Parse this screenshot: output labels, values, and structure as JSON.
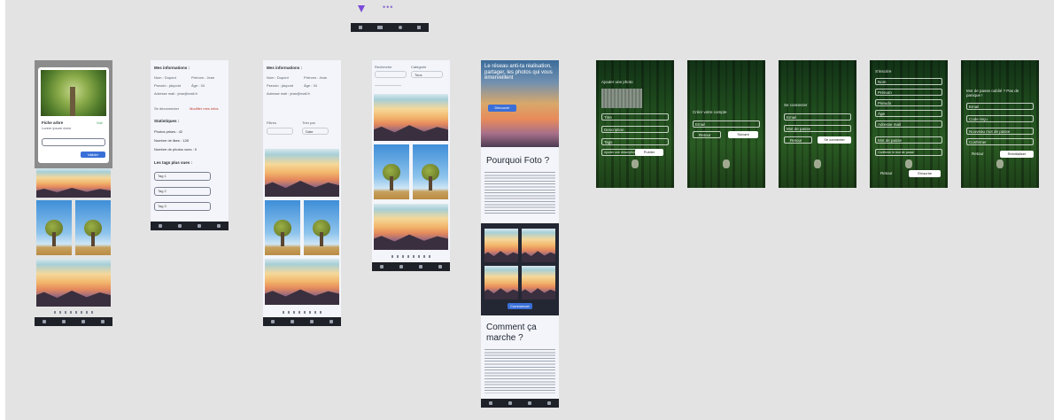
{
  "colors": {
    "canvas_bg": "#e3e3e3",
    "frame_bg": "#f3f5fa",
    "navbar_bg": "#1e2128",
    "accent_blue": "#3a6fd8",
    "link_red": "#c0392b",
    "selection_border": "#8c8c8c",
    "plugin_purple": "#7b4bd8"
  },
  "icons": [
    "component-icon",
    "home-icon",
    "search-icon",
    "back-icon",
    "menu-icon"
  ],
  "toolbar_top": {
    "badge": "•••"
  },
  "frame1": {
    "card_title": "Fiche arbre",
    "card_link": "Voir",
    "card_sub": "Lorem ipsum dolor",
    "card_btn": "Valider"
  },
  "frame2": {
    "title": "Mes informations :",
    "info_rows": [
      {
        "label": "Nom :",
        "value": "Dupont",
        "label2": "Prénom :",
        "value2": "Jean"
      },
      {
        "label": "Pseudo :",
        "value": "jdupont",
        "label2": "Âge :",
        "value2": "34"
      },
      {
        "label": "Adresse mail :",
        "value": "jean@mail.fr",
        "label2": "",
        "value2": ""
      }
    ],
    "logout": "Se déconnecter",
    "edit_link": "Modifier mes infos",
    "stats_title": "Statistiques :",
    "stats": [
      "Photos prises : 42",
      "Nombre de likes : 128",
      "Nombre de photos vues : 9"
    ],
    "tags_title": "Les tags plus vues :",
    "tags": [
      "Tag 1",
      "Tag 2",
      "Tag 3"
    ]
  },
  "frame3": {
    "title": "Mes informations :",
    "info_rows": [
      {
        "label": "Nom :",
        "value": "Dupont",
        "label2": "Prénom :",
        "value2": "Jean"
      },
      {
        "label": "Pseudo :",
        "value": "jdupont",
        "label2": "Âge :",
        "value2": "34"
      },
      {
        "label": "Adresse mail :",
        "value": "jean@mail.fr",
        "label2": "",
        "value2": ""
      }
    ],
    "field_a": "Filtres",
    "field_b": "Trier par",
    "field_value": "Date"
  },
  "frame4": {
    "field_a": "Recherche",
    "field_b": "Catégorie",
    "field_c": "Tous"
  },
  "landing": {
    "hero_text": "Le réseau anti-ta réalisation, partager, les photos qui vous émerveillent",
    "hero_btn": "Découvrir",
    "why_title": "Pourquoi Foto ?",
    "gallery_btn": "Commencer",
    "how_title": "Comment ça marche ?"
  },
  "forest_screens": [
    {
      "heading": "Ajouter une photo",
      "fields": [
        "Titre",
        "Description",
        "Tags",
        "Ajouter une description"
      ],
      "primary": "Publier"
    },
    {
      "heading": "Créer votre compte",
      "fields": [
        "Email"
      ],
      "secondary": "Retour",
      "primary": "Suivant"
    },
    {
      "heading": "Se connecter",
      "fields": [
        "Email",
        "Mot de passe"
      ],
      "secondary": "Retour",
      "primary": "Se connecter"
    },
    {
      "heading": "S'inscrire",
      "fields": [
        "Nom",
        "Prénom",
        "Pseudo",
        "Âge",
        "Adresse mail",
        "Mot de passe",
        "Confirmer le mot de passe"
      ],
      "secondary": "Retour",
      "primary": "S'inscrire"
    },
    {
      "heading": "Mot de passe oublié ? Pas de panique !",
      "fields": [
        "Email",
        "Code reçu",
        "Nouveau mot de passe",
        "Confirmer"
      ],
      "secondary": "Retour",
      "primary": "Réinitialiser"
    }
  ]
}
